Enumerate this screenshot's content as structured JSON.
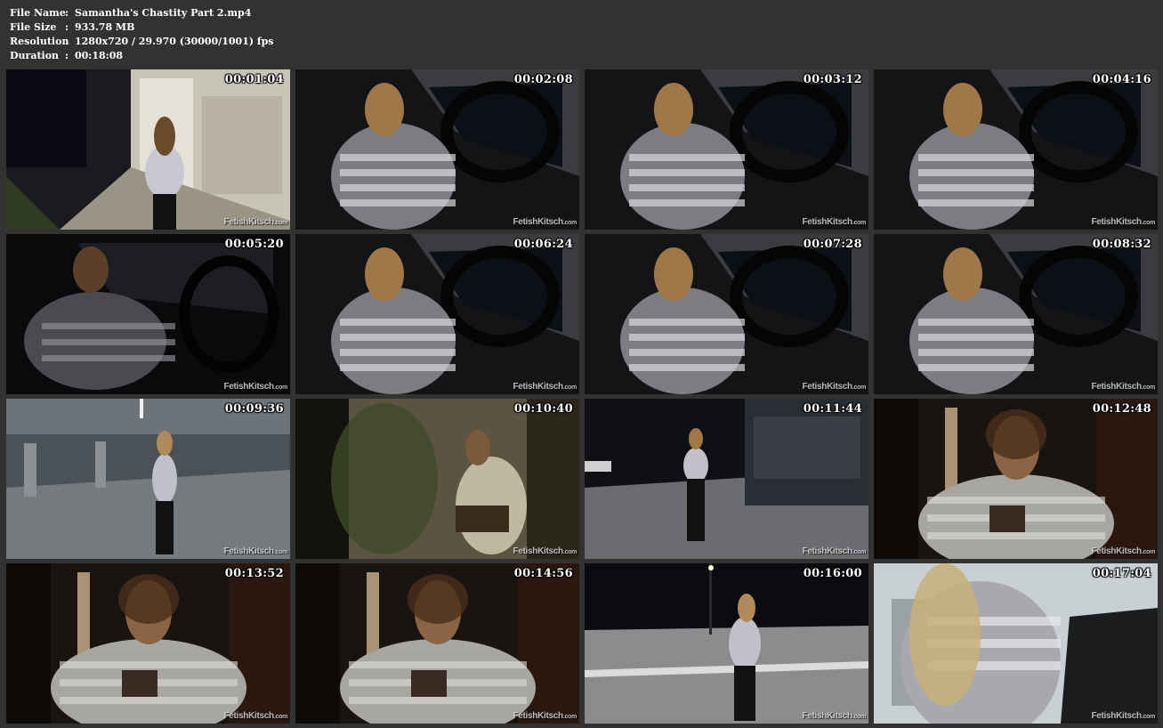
{
  "info": {
    "rows": [
      {
        "label": "File Name",
        "sep": ":",
        "value": "Samantha's Chastity Part 2.mp4"
      },
      {
        "label": "File Size",
        "sep": ":",
        "value": "933.78 MB"
      },
      {
        "label": "Resolution",
        "sep": ":",
        "value": "1280x720 / 29.970 (30000/1001) fps"
      },
      {
        "label": "Duration",
        "sep": ":",
        "value": "00:18:08"
      }
    ]
  },
  "watermark": {
    "main": "FetishKitsch",
    "suffix": ".com"
  },
  "thumbnails": [
    {
      "time": "00:01:04",
      "scene": "storefront-walk"
    },
    {
      "time": "00:02:08",
      "scene": "car-night"
    },
    {
      "time": "00:03:12",
      "scene": "car-night"
    },
    {
      "time": "00:04:16",
      "scene": "car-night"
    },
    {
      "time": "00:05:20",
      "scene": "car-dark"
    },
    {
      "time": "00:06:24",
      "scene": "car-night"
    },
    {
      "time": "00:07:28",
      "scene": "car-night"
    },
    {
      "time": "00:08:32",
      "scene": "car-night"
    },
    {
      "time": "00:09:36",
      "scene": "parking-garage"
    },
    {
      "time": "00:10:40",
      "scene": "ivy-wall"
    },
    {
      "time": "00:11:44",
      "scene": "street-night"
    },
    {
      "time": "00:12:48",
      "scene": "patio-night"
    },
    {
      "time": "00:13:52",
      "scene": "patio-night"
    },
    {
      "time": "00:14:56",
      "scene": "patio-night"
    },
    {
      "time": "00:16:00",
      "scene": "crosswalk-night"
    },
    {
      "time": "00:17:04",
      "scene": "car-door"
    }
  ],
  "colors": {
    "background": "#323232",
    "text": "#ffffff"
  }
}
